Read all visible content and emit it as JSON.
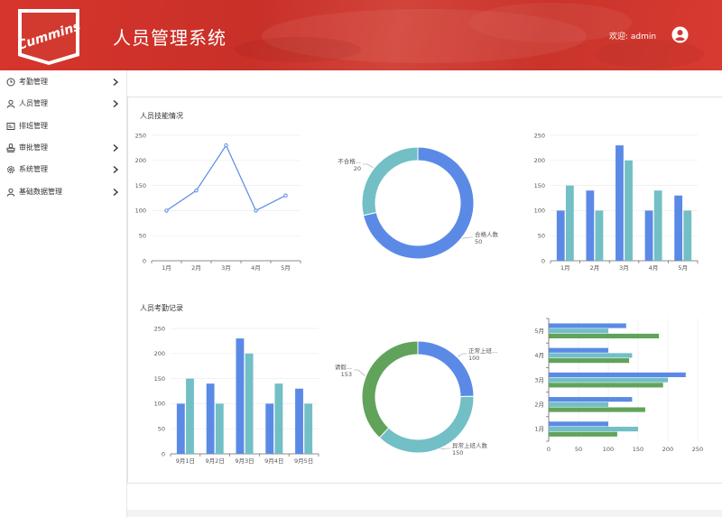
{
  "header": {
    "app_title": "人员管理系统",
    "welcome_text": "欢迎: admin",
    "logo_text": "Cummins",
    "brand_color": "#d23a30"
  },
  "sidebar": {
    "items": [
      {
        "label": "考勤管理",
        "icon": "clock-icon",
        "has_submenu": true
      },
      {
        "label": "人员管理",
        "icon": "user-icon",
        "has_submenu": true
      },
      {
        "label": "排班管理",
        "icon": "schedule-icon",
        "has_submenu": false
      },
      {
        "label": "审批管理",
        "icon": "stamp-icon",
        "has_submenu": true
      },
      {
        "label": "系统管理",
        "icon": "gear-icon",
        "has_submenu": true
      },
      {
        "label": "基础数据管理",
        "icon": "user-data-icon",
        "has_submenu": true
      }
    ]
  },
  "sections": {
    "skills_title": "人员技能情况",
    "attendance_title": "人员考勤记录"
  },
  "colors": {
    "blue": "#5b8ae6",
    "teal": "#72bfc6",
    "green": "#61a35a",
    "axis": "#666666",
    "grid": "#eeeeee"
  },
  "chart_data": [
    {
      "type": "line",
      "categories": [
        "1月",
        "2月",
        "3月",
        "4月",
        "5月"
      ],
      "series": [
        {
          "values": [
            100,
            140,
            230,
            100,
            130
          ]
        }
      ],
      "ylim": [
        0,
        250
      ],
      "yticks": [
        0,
        50,
        100,
        150,
        200,
        250
      ]
    },
    {
      "type": "pie",
      "donut": true,
      "slices": [
        {
          "label": "合格人数",
          "value": 50
        },
        {
          "label": "不合格...",
          "value": 20
        }
      ]
    },
    {
      "type": "bar",
      "categories": [
        "1月",
        "2月",
        "3月",
        "4月",
        "5月"
      ],
      "series": [
        {
          "values": [
            100,
            140,
            230,
            100,
            130
          ]
        },
        {
          "values": [
            150,
            100,
            200,
            140,
            100
          ]
        }
      ],
      "ylim": [
        0,
        250
      ],
      "yticks": [
        0,
        50,
        100,
        150,
        200,
        250
      ]
    },
    {
      "type": "bar",
      "categories": [
        "9月1日",
        "9月2日",
        "9月3日",
        "9月4日",
        "9月5日"
      ],
      "series": [
        {
          "values": [
            100,
            140,
            230,
            100,
            130
          ]
        },
        {
          "values": [
            150,
            100,
            200,
            140,
            100
          ]
        }
      ],
      "ylim": [
        0,
        250
      ],
      "yticks": [
        0,
        50,
        100,
        150,
        200,
        250
      ]
    },
    {
      "type": "pie",
      "donut": true,
      "slices": [
        {
          "label": "正常上班...",
          "value": 100
        },
        {
          "label": "异常上班人数",
          "value": 150
        },
        {
          "label": "请假...",
          "value": 153
        }
      ]
    },
    {
      "type": "bar",
      "orientation": "horizontal",
      "categories": [
        "1月",
        "2月",
        "3月",
        "4月",
        "5月"
      ],
      "series": [
        {
          "values": [
            100,
            140,
            230,
            100,
            130
          ]
        },
        {
          "values": [
            150,
            100,
            200,
            140,
            100
          ]
        },
        {
          "values": [
            115,
            162,
            192,
            135,
            185
          ]
        }
      ],
      "xlim": [
        0,
        250
      ],
      "xticks": [
        0,
        50,
        100,
        150,
        200,
        250
      ]
    }
  ]
}
